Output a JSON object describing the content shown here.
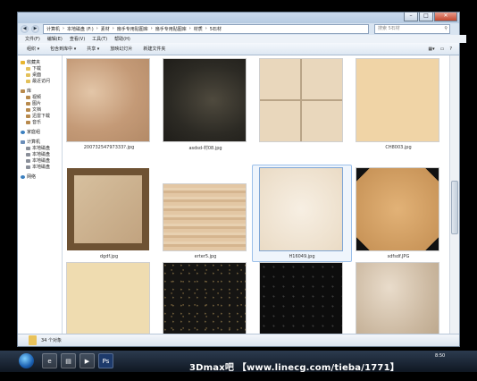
{
  "address": {
    "segments": [
      "计算机",
      "本地磁盘 (F:)",
      "素材",
      "扇手专用贴图库",
      "扇手专用贴图库",
      "材质",
      "5石材"
    ],
    "search_placeholder": "搜索 5石材"
  },
  "menu": [
    "文件(F)",
    "编辑(E)",
    "查看(V)",
    "工具(T)",
    "帮助(H)"
  ],
  "toolbar": {
    "organize": "组织 ▾",
    "include": "包含到库中 ▾",
    "share": "共享 ▾",
    "slideshow": "放映幻灯片",
    "new_folder": "新建文件夹"
  },
  "sidebar": {
    "favorites": "收藏夹",
    "favorites_items": [
      "下载",
      "桌面",
      "最近访问"
    ],
    "libraries": "库",
    "library_items": [
      "视频",
      "图片",
      "文档",
      "迅雷下载",
      "音乐"
    ],
    "homegroup": "家庭组",
    "computer": "计算机",
    "drives": [
      "本地磁盘",
      "本地磁盘",
      "本地磁盘",
      "本地磁盘"
    ],
    "network": "网络"
  },
  "files": [
    {
      "name": "20073254797333?.jpg"
    },
    {
      "name": "asdsd-村08.jpg"
    },
    {
      "name": ""
    },
    {
      "name": "CH8003.jpg"
    },
    {
      "name": "dgdf.jpg"
    },
    {
      "name": "erter5.jpg"
    },
    {
      "name": "H16049.jpg"
    },
    {
      "name": "sdfsdf.JPG"
    },
    {
      "name": ""
    },
    {
      "name": ""
    },
    {
      "name": ""
    },
    {
      "name": ""
    }
  ],
  "status": {
    "count": "34 个对象"
  },
  "clock": {
    "time": "8:50",
    "date": ""
  },
  "watermark": "3Dmax吧 【www.linecg.com/tieba/1771】",
  "colors": {
    "window_frame": "#d8e4f1",
    "taskbar": "#1b2636",
    "close": "#c4482f"
  }
}
